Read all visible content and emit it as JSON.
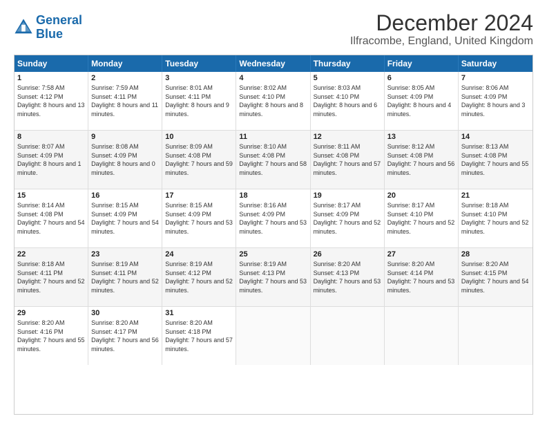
{
  "logo": {
    "line1": "General",
    "line2": "Blue"
  },
  "title": "December 2024",
  "subtitle": "Ilfracombe, England, United Kingdom",
  "calendar": {
    "headers": [
      "Sunday",
      "Monday",
      "Tuesday",
      "Wednesday",
      "Thursday",
      "Friday",
      "Saturday"
    ],
    "rows": [
      [
        {
          "day": "1",
          "sunrise": "7:58 AM",
          "sunset": "4:12 PM",
          "daylight": "8 hours and 13 minutes."
        },
        {
          "day": "2",
          "sunrise": "7:59 AM",
          "sunset": "4:11 PM",
          "daylight": "8 hours and 11 minutes."
        },
        {
          "day": "3",
          "sunrise": "8:01 AM",
          "sunset": "4:11 PM",
          "daylight": "8 hours and 9 minutes."
        },
        {
          "day": "4",
          "sunrise": "8:02 AM",
          "sunset": "4:10 PM",
          "daylight": "8 hours and 8 minutes."
        },
        {
          "day": "5",
          "sunrise": "8:03 AM",
          "sunset": "4:10 PM",
          "daylight": "8 hours and 6 minutes."
        },
        {
          "day": "6",
          "sunrise": "8:05 AM",
          "sunset": "4:09 PM",
          "daylight": "8 hours and 4 minutes."
        },
        {
          "day": "7",
          "sunrise": "8:06 AM",
          "sunset": "4:09 PM",
          "daylight": "8 hours and 3 minutes."
        }
      ],
      [
        {
          "day": "8",
          "sunrise": "8:07 AM",
          "sunset": "4:09 PM",
          "daylight": "8 hours and 1 minute."
        },
        {
          "day": "9",
          "sunrise": "8:08 AM",
          "sunset": "4:09 PM",
          "daylight": "8 hours and 0 minutes."
        },
        {
          "day": "10",
          "sunrise": "8:09 AM",
          "sunset": "4:08 PM",
          "daylight": "7 hours and 59 minutes."
        },
        {
          "day": "11",
          "sunrise": "8:10 AM",
          "sunset": "4:08 PM",
          "daylight": "7 hours and 58 minutes."
        },
        {
          "day": "12",
          "sunrise": "8:11 AM",
          "sunset": "4:08 PM",
          "daylight": "7 hours and 57 minutes."
        },
        {
          "day": "13",
          "sunrise": "8:12 AM",
          "sunset": "4:08 PM",
          "daylight": "7 hours and 56 minutes."
        },
        {
          "day": "14",
          "sunrise": "8:13 AM",
          "sunset": "4:08 PM",
          "daylight": "7 hours and 55 minutes."
        }
      ],
      [
        {
          "day": "15",
          "sunrise": "8:14 AM",
          "sunset": "4:08 PM",
          "daylight": "7 hours and 54 minutes."
        },
        {
          "day": "16",
          "sunrise": "8:15 AM",
          "sunset": "4:09 PM",
          "daylight": "7 hours and 54 minutes."
        },
        {
          "day": "17",
          "sunrise": "8:15 AM",
          "sunset": "4:09 PM",
          "daylight": "7 hours and 53 minutes."
        },
        {
          "day": "18",
          "sunrise": "8:16 AM",
          "sunset": "4:09 PM",
          "daylight": "7 hours and 53 minutes."
        },
        {
          "day": "19",
          "sunrise": "8:17 AM",
          "sunset": "4:09 PM",
          "daylight": "7 hours and 52 minutes."
        },
        {
          "day": "20",
          "sunrise": "8:17 AM",
          "sunset": "4:10 PM",
          "daylight": "7 hours and 52 minutes."
        },
        {
          "day": "21",
          "sunrise": "8:18 AM",
          "sunset": "4:10 PM",
          "daylight": "7 hours and 52 minutes."
        }
      ],
      [
        {
          "day": "22",
          "sunrise": "8:18 AM",
          "sunset": "4:11 PM",
          "daylight": "7 hours and 52 minutes."
        },
        {
          "day": "23",
          "sunrise": "8:19 AM",
          "sunset": "4:11 PM",
          "daylight": "7 hours and 52 minutes."
        },
        {
          "day": "24",
          "sunrise": "8:19 AM",
          "sunset": "4:12 PM",
          "daylight": "7 hours and 52 minutes."
        },
        {
          "day": "25",
          "sunrise": "8:19 AM",
          "sunset": "4:13 PM",
          "daylight": "7 hours and 53 minutes."
        },
        {
          "day": "26",
          "sunrise": "8:20 AM",
          "sunset": "4:13 PM",
          "daylight": "7 hours and 53 minutes."
        },
        {
          "day": "27",
          "sunrise": "8:20 AM",
          "sunset": "4:14 PM",
          "daylight": "7 hours and 53 minutes."
        },
        {
          "day": "28",
          "sunrise": "8:20 AM",
          "sunset": "4:15 PM",
          "daylight": "7 hours and 54 minutes."
        }
      ],
      [
        {
          "day": "29",
          "sunrise": "8:20 AM",
          "sunset": "4:16 PM",
          "daylight": "7 hours and 55 minutes."
        },
        {
          "day": "30",
          "sunrise": "8:20 AM",
          "sunset": "4:17 PM",
          "daylight": "7 hours and 56 minutes."
        },
        {
          "day": "31",
          "sunrise": "8:20 AM",
          "sunset": "4:18 PM",
          "daylight": "7 hours and 57 minutes."
        },
        null,
        null,
        null,
        null
      ]
    ]
  }
}
